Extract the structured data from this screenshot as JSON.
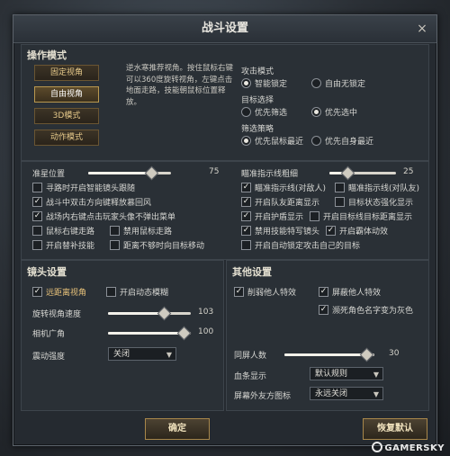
{
  "dialog": {
    "title": "战斗设置",
    "close_label": "×"
  },
  "ops": {
    "title": "操作模式",
    "modes": [
      {
        "label": "固定视角",
        "active": false
      },
      {
        "label": "自由视角",
        "active": true
      },
      {
        "label": "3D模式",
        "active": false
      },
      {
        "label": "动作模式",
        "active": false
      }
    ],
    "description": "逆水寒推荐视角。按住鼠标右键可以360度旋转视角，左键点击地面走路，技能朝鼠标位置释放。",
    "attack": {
      "label": "攻击模式",
      "options": [
        {
          "label": "智能锁定",
          "checked": true
        },
        {
          "label": "自由无锁定",
          "checked": false
        }
      ]
    },
    "target": {
      "label": "目标选择",
      "options": [
        {
          "label": "优先筛选",
          "checked": false
        },
        {
          "label": "优先选中",
          "checked": true
        }
      ]
    },
    "filter": {
      "label": "筛选策略",
      "options": [
        {
          "label": "优先鼠标最近",
          "checked": true
        },
        {
          "label": "优先自身最近",
          "checked": false
        }
      ]
    }
  },
  "general": {
    "crosshair": {
      "label": "准星位置",
      "value": "75",
      "fraction": 0.75
    },
    "aim_thickness": {
      "label": "瞄准指示线粗细",
      "value": "25",
      "fraction": 0.25
    },
    "left_checks": [
      {
        "label": "寻路时开启智能镜头跟随",
        "checked": false
      },
      {
        "label": "战斗中双击方向键释放慕回风",
        "checked": true
      },
      {
        "label": "战场内右键点击玩家头像不弹出菜单",
        "checked": true
      }
    ],
    "right_checks": [
      {
        "label": "瞄准指示线(对敌人)",
        "checked": true
      },
      {
        "label": "瞄准指示线(对队友)",
        "checked": false
      },
      {
        "label": "开启队友距离显示",
        "checked": true
      },
      {
        "label": "目标状态强化显示",
        "checked": false
      },
      {
        "label": "开启护盾显示",
        "checked": true
      },
      {
        "label": "开启目标线目标距离显示",
        "checked": false
      },
      {
        "label": "禁用技能特写镜头",
        "checked": true
      },
      {
        "label": "开启霸体动效",
        "checked": true
      },
      {
        "label": "开启自动锁定攻击自己的目标",
        "checked": false
      }
    ],
    "left_pairs": [
      {
        "label": "鼠标右键走路",
        "checked": false
      },
      {
        "label": "禁用鼠标走路",
        "checked": false
      },
      {
        "label": "开启替补技能",
        "checked": false
      },
      {
        "label": "距离不够时向目标移动",
        "checked": false
      }
    ]
  },
  "camera": {
    "title": "镜头设置",
    "far_view": {
      "label": "远距离视角",
      "checked": true
    },
    "motion_blur": {
      "label": "开启动态模糊",
      "checked": false
    },
    "rotate_speed": {
      "label": "旋转视角速度",
      "value": "103",
      "fraction": 0.66
    },
    "fov": {
      "label": "相机广角",
      "value": "100",
      "fraction": 0.9
    },
    "shake": {
      "label": "震动强度",
      "value": "关闭"
    }
  },
  "other": {
    "title": "其他设置",
    "weaken_effects": {
      "label": "削弱他人特效",
      "checked": true
    },
    "block_effects": {
      "label": "屏蔽他人特效",
      "checked": true
    },
    "dying_gray": {
      "label": "濒死角色名字变为灰色",
      "checked": true
    },
    "same_screen": {
      "label": "同屏人数",
      "value": "30",
      "fraction": 0.9
    },
    "blood_bar": {
      "label": "血条显示",
      "value": "默认规则"
    },
    "offscreen_icon": {
      "label": "屏幕外友方图标",
      "value": "永远关闭"
    }
  },
  "footer": {
    "confirm_label": "确定",
    "restore_label": "恢复默认"
  },
  "watermark": "GAMERSKY"
}
